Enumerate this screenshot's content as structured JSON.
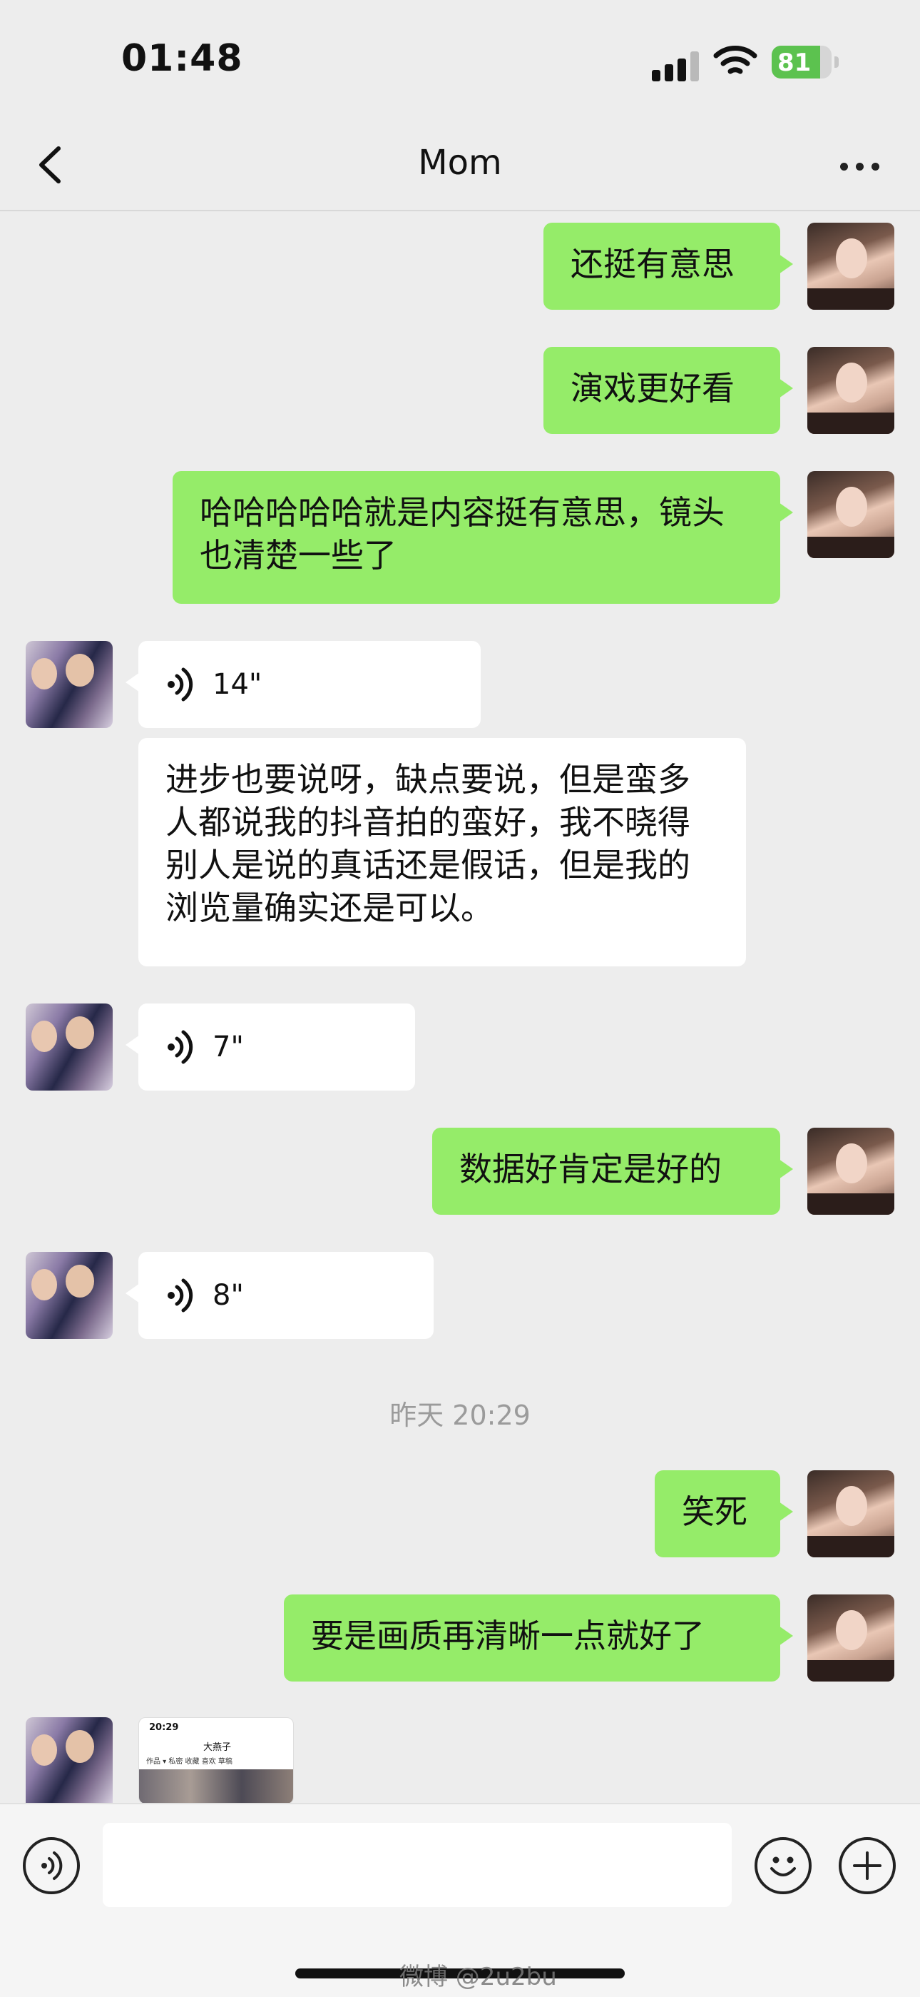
{
  "status_bar": {
    "time": "01:48",
    "battery": "81",
    "battery_level": 0.81
  },
  "header": {
    "title": "Mom"
  },
  "messages": {
    "m1": "还挺有意思",
    "m2": "演戏更好看",
    "m3": "哈哈哈哈哈就是内容挺有意思，镜头也清楚一些了",
    "v1": "14\"",
    "m4": "进步也要说呀，缺点要说，但是蛮多人都说我的抖音拍的蛮好，我不晓得别人是说的真话还是假话，但是我的浏览量确实还是可以。",
    "v2": "7\"",
    "m5": "数据好肯定是好的",
    "v3": "8\"",
    "timestamp": "昨天 20:29",
    "m6": "笑死",
    "m7": "要是画质再清晰一点就好了"
  },
  "thumbnail": {
    "time": "20:29",
    "title": "大燕子",
    "tabs": "作品 ▾   私密   收藏   喜欢   草稿"
  },
  "input_bar": {
    "text_value": ""
  },
  "watermark": "微博 @2u2bu",
  "colors": {
    "sent_bubble": "#95ec69",
    "received_bubble": "#ffffff",
    "background": "#ededed",
    "battery_fill": "#5cc24f"
  },
  "icons": [
    "back-icon",
    "more-icon",
    "voice-wave-icon",
    "voice-mode-icon",
    "emoji-icon",
    "add-icon",
    "wifi-icon",
    "signal-icon",
    "battery-icon"
  ]
}
